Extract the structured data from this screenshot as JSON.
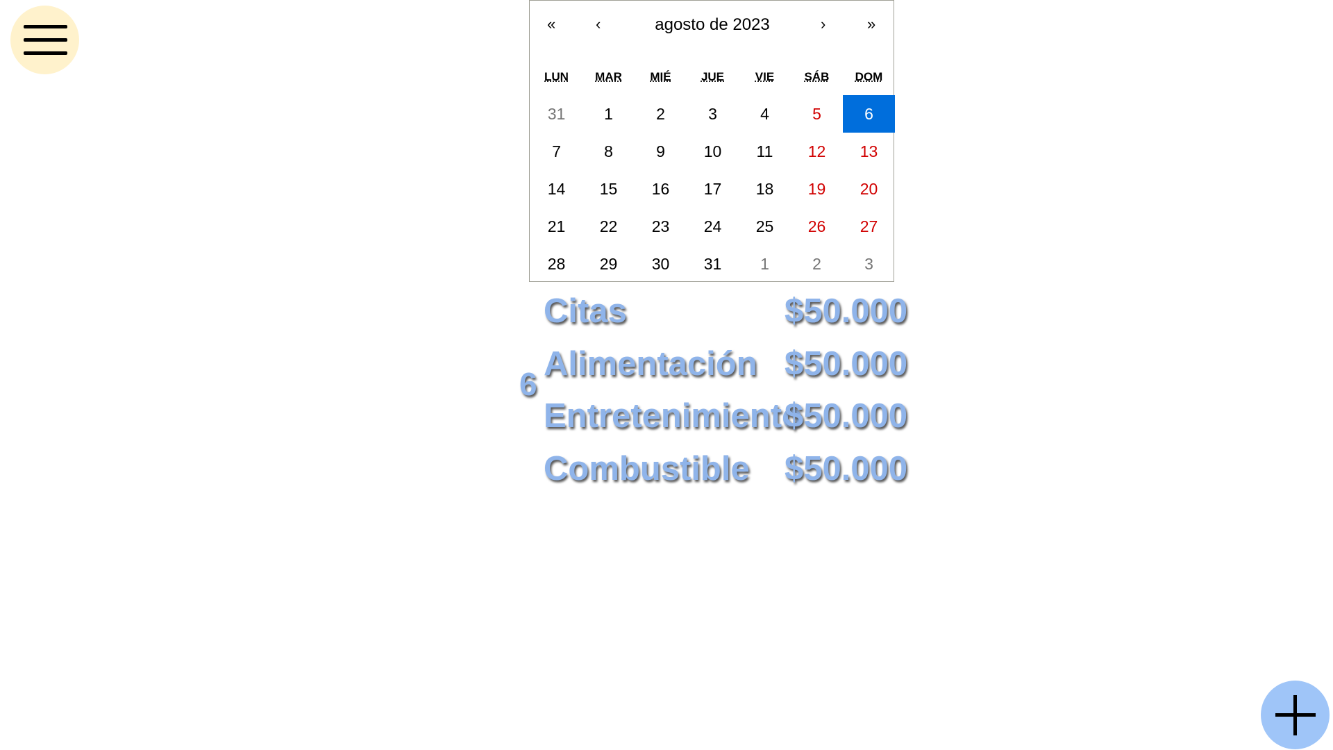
{
  "menu": {
    "icon": "hamburger-menu-icon"
  },
  "calendar": {
    "nav": {
      "prev_year": "«",
      "prev_month": "‹",
      "next_month": "›",
      "next_year": "»"
    },
    "month_label": "agosto de 2023",
    "weekdays": [
      "LUN",
      "MAR",
      "MIÉ",
      "JUE",
      "VIE",
      "SÁB",
      "DOM"
    ],
    "weeks": [
      [
        "31",
        "1",
        "2",
        "3",
        "4",
        "5",
        "6"
      ],
      [
        "7",
        "8",
        "9",
        "10",
        "11",
        "12",
        "13"
      ],
      [
        "14",
        "15",
        "16",
        "17",
        "18",
        "19",
        "20"
      ],
      [
        "21",
        "22",
        "23",
        "24",
        "25",
        "26",
        "27"
      ],
      [
        "28",
        "29",
        "30",
        "31",
        "1",
        "2",
        "3"
      ]
    ],
    "selected_day": "6",
    "colors": {
      "selected": "#006edc",
      "weekend": "#d10000",
      "other_month": "#757575"
    }
  },
  "expenses": {
    "day": "6",
    "items": [
      {
        "category": "Citas",
        "amount": "$50.000"
      },
      {
        "category": "Alimentación",
        "amount": "$50.000"
      },
      {
        "category": "Entretenimiento",
        "amount": "$50.000"
      },
      {
        "category": "Combustible",
        "amount": "$50.000"
      }
    ],
    "text_color": "#8fb4ea"
  },
  "add_button": {
    "icon": "plus-icon"
  }
}
